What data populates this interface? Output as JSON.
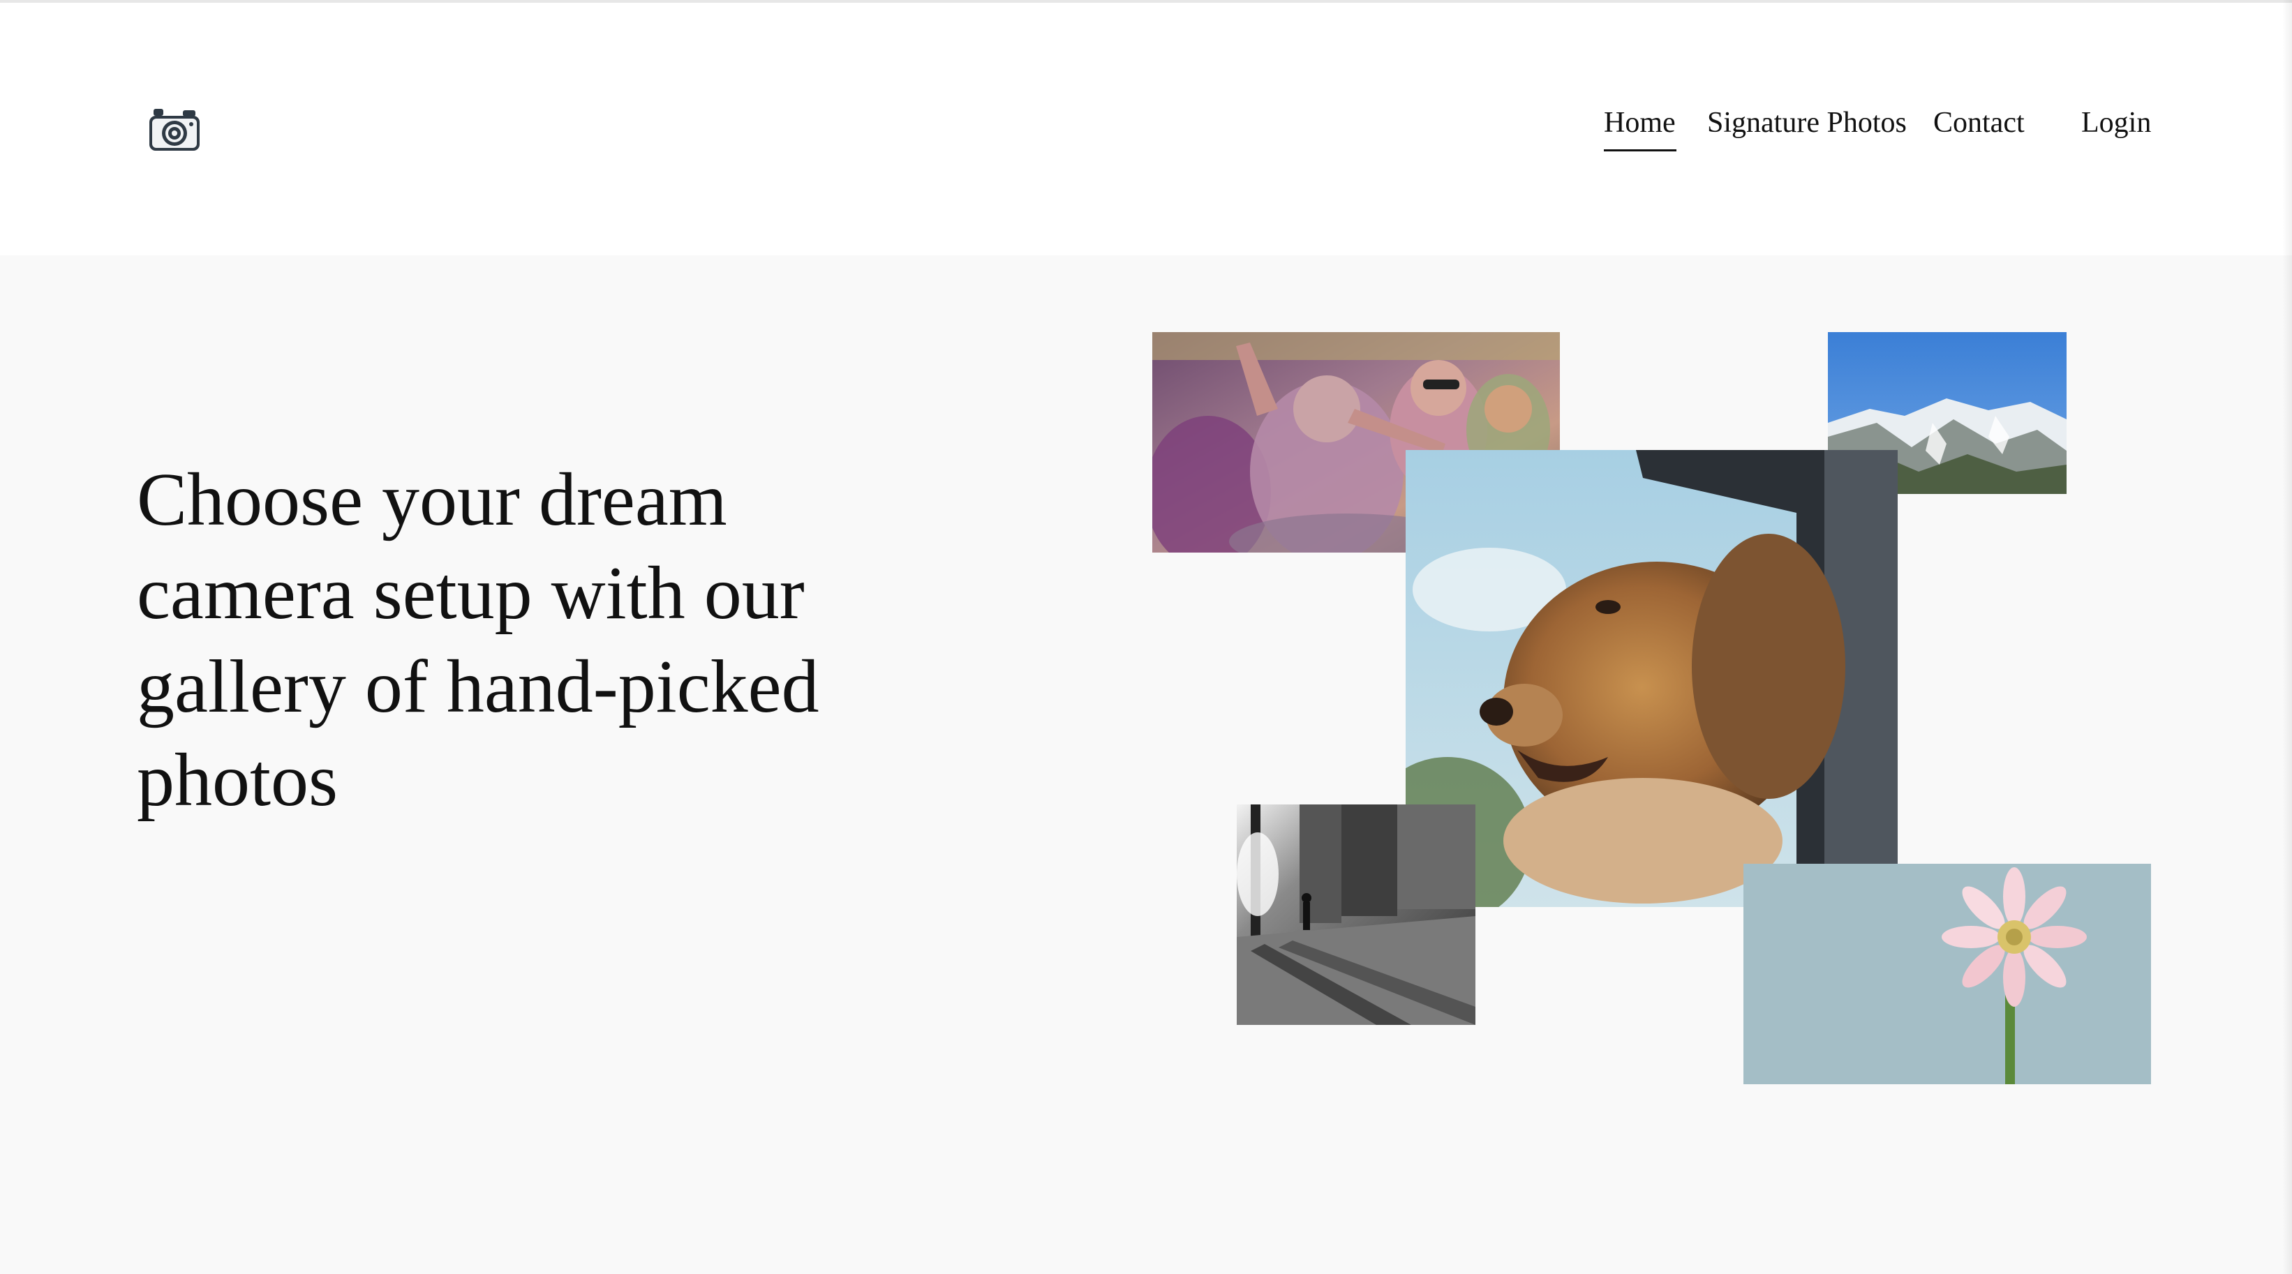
{
  "header": {
    "logo_icon": "camera-icon",
    "nav": {
      "home": "Home",
      "signature_photos": "Signature Photos",
      "contact": "Contact",
      "login": "Login",
      "active": "Home"
    }
  },
  "hero": {
    "title": "Choose your dream camera setup with our gallery of hand-picked photos"
  },
  "gallery": {
    "photos": [
      {
        "subject": "holi-festival-crowd"
      },
      {
        "subject": "snowy-mountains"
      },
      {
        "subject": "dog-in-car-window"
      },
      {
        "subject": "city-street-black-and-white"
      },
      {
        "subject": "pink-gerbera-flower"
      }
    ]
  },
  "colors": {
    "background": "#f9f9f9",
    "header_background": "#ffffff",
    "text": "#111111"
  }
}
